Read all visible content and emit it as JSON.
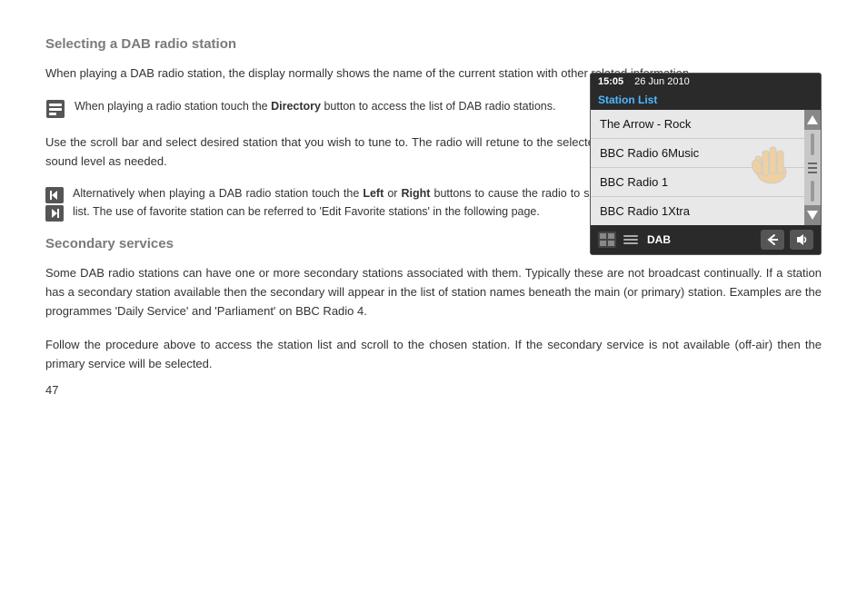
{
  "page": {
    "number": "47"
  },
  "section1": {
    "heading": "Selecting a DAB radio station",
    "intro_text": "When playing a DAB radio station, the display normally shows the name of the current station with other related information.",
    "note1": {
      "text_before": "When playing a radio station touch the ",
      "bold": "Directory",
      "text_after": " button to access the list of DAB radio stations."
    },
    "instruction_text": "Use the scroll bar and select desired station that you wish to tune to. The radio will retune to the selected station. Use the volume control to set the sound level as needed.",
    "note2": {
      "text_before": "Alternatively when playing a DAB radio station touch the ",
      "bold1": "Left",
      "text_middle": " or ",
      "bold2": "Right",
      "text_after": " buttons to cause the radio to select wither the next or previous station in the list. The use of favorite station can be referred to 'Edit Favorite stations' in the following page."
    }
  },
  "section2": {
    "heading": "Secondary services",
    "para1": "Some DAB radio stations can have one or more secondary stations associated with them. Typically these are not broadcast continually. If a station has a secondary station available then the secondary will appear in the list of station names beneath the main (or primary) station. Examples are the programmes 'Daily Service' and 'Parliament' on BBC Radio 4.",
    "para2": "Follow the procedure above to access the station list and scroll to the chosen station. If the secondary service is not available (off-air) then the primary service will be selected."
  },
  "radio_display": {
    "time": "15:05",
    "date": "26 Jun 2010",
    "station_list_label": "Station List",
    "stations": [
      {
        "name": "The Arrow - Rock"
      },
      {
        "name": "BBC Radio 6Music"
      },
      {
        "name": "BBC Radio 1"
      },
      {
        "name": "BBC Radio 1Xtra"
      }
    ],
    "mode_label": "DAB"
  }
}
